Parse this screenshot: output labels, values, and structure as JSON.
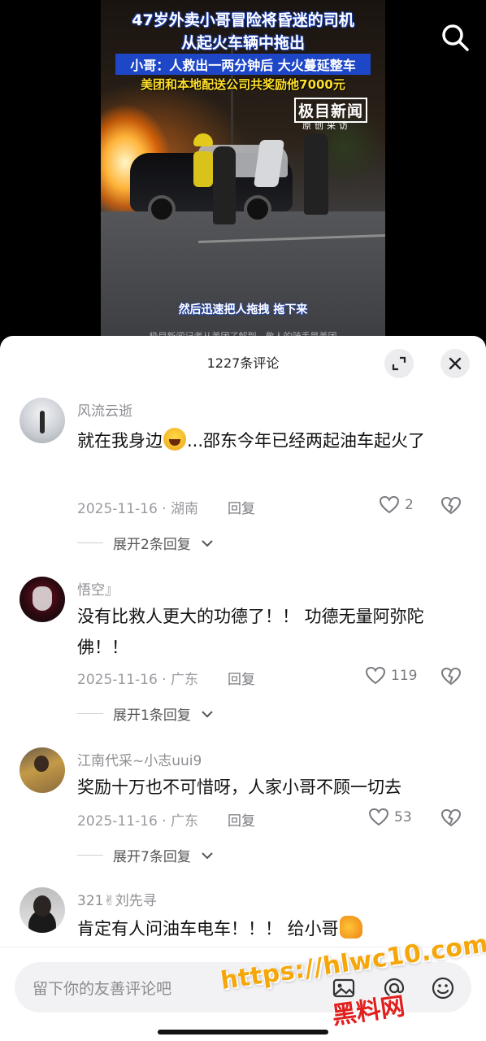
{
  "video": {
    "headline_1": "47岁外卖小哥冒险将昏迷的司机",
    "headline_2": "从起火车辆中拖出",
    "headline_3": "小哥：人救出一两分钟后 大火蔓延整车",
    "headline_4": "美团和本地配送公司共奖励他7000元",
    "brand": "极目新闻",
    "brand_sub": "原创采访",
    "subtitle": "然后迅速把人拖拽 拖下来",
    "subtitle_2": "极目新闻记者从美团了解到，救人的骑手是美团"
  },
  "sheet": {
    "comment_count": "1227条评论"
  },
  "comments": [
    {
      "user": "风流云逝",
      "text_before_emoji": "就在我身边",
      "text_after_emoji": "...邵东今年已经两起油车起火了",
      "date": "2025-11-16",
      "location": "湖南",
      "reply": "回复",
      "likes": "2",
      "expand": "展开2条回复"
    },
    {
      "user": "悟空』",
      "text": "没有比救人更大的功德了！！ 功德无量阿弥陀佛！！",
      "date": "2025-11-16",
      "location": "广东",
      "reply": "回复",
      "likes": "119",
      "expand": "展开1条回复"
    },
    {
      "user": "江南代采~小志uui9",
      "text": "奖励十万也不可惜呀，人家小哥不顾一切去",
      "date": "2025-11-16",
      "location": "广东",
      "reply": "回复",
      "likes": "53",
      "expand": "展开7条回复"
    },
    {
      "user": "321✌刘先寻",
      "text_before_emoji": "肯定有人问油车电车！！！ 给小哥",
      "text_after_emoji": ""
    }
  ],
  "input": {
    "placeholder": "留下你的友善评论吧"
  },
  "watermark": {
    "url": "https://hlwc10.com",
    "name": "黑料网"
  },
  "icons": {
    "search": "search-icon",
    "expand": "expand-icon",
    "close": "close-icon",
    "like": "heart-icon",
    "dislike": "broken-heart-icon",
    "chevron": "chevron-down-icon",
    "emoji": "emoji-icon",
    "at": "at-icon",
    "image": "image-icon"
  },
  "colors": {
    "headline_blue": "#1e47c8",
    "headline_yellow": "#ffdf2a",
    "watermark_orange": "#f5a70a",
    "watermark_red": "#e0201e"
  }
}
